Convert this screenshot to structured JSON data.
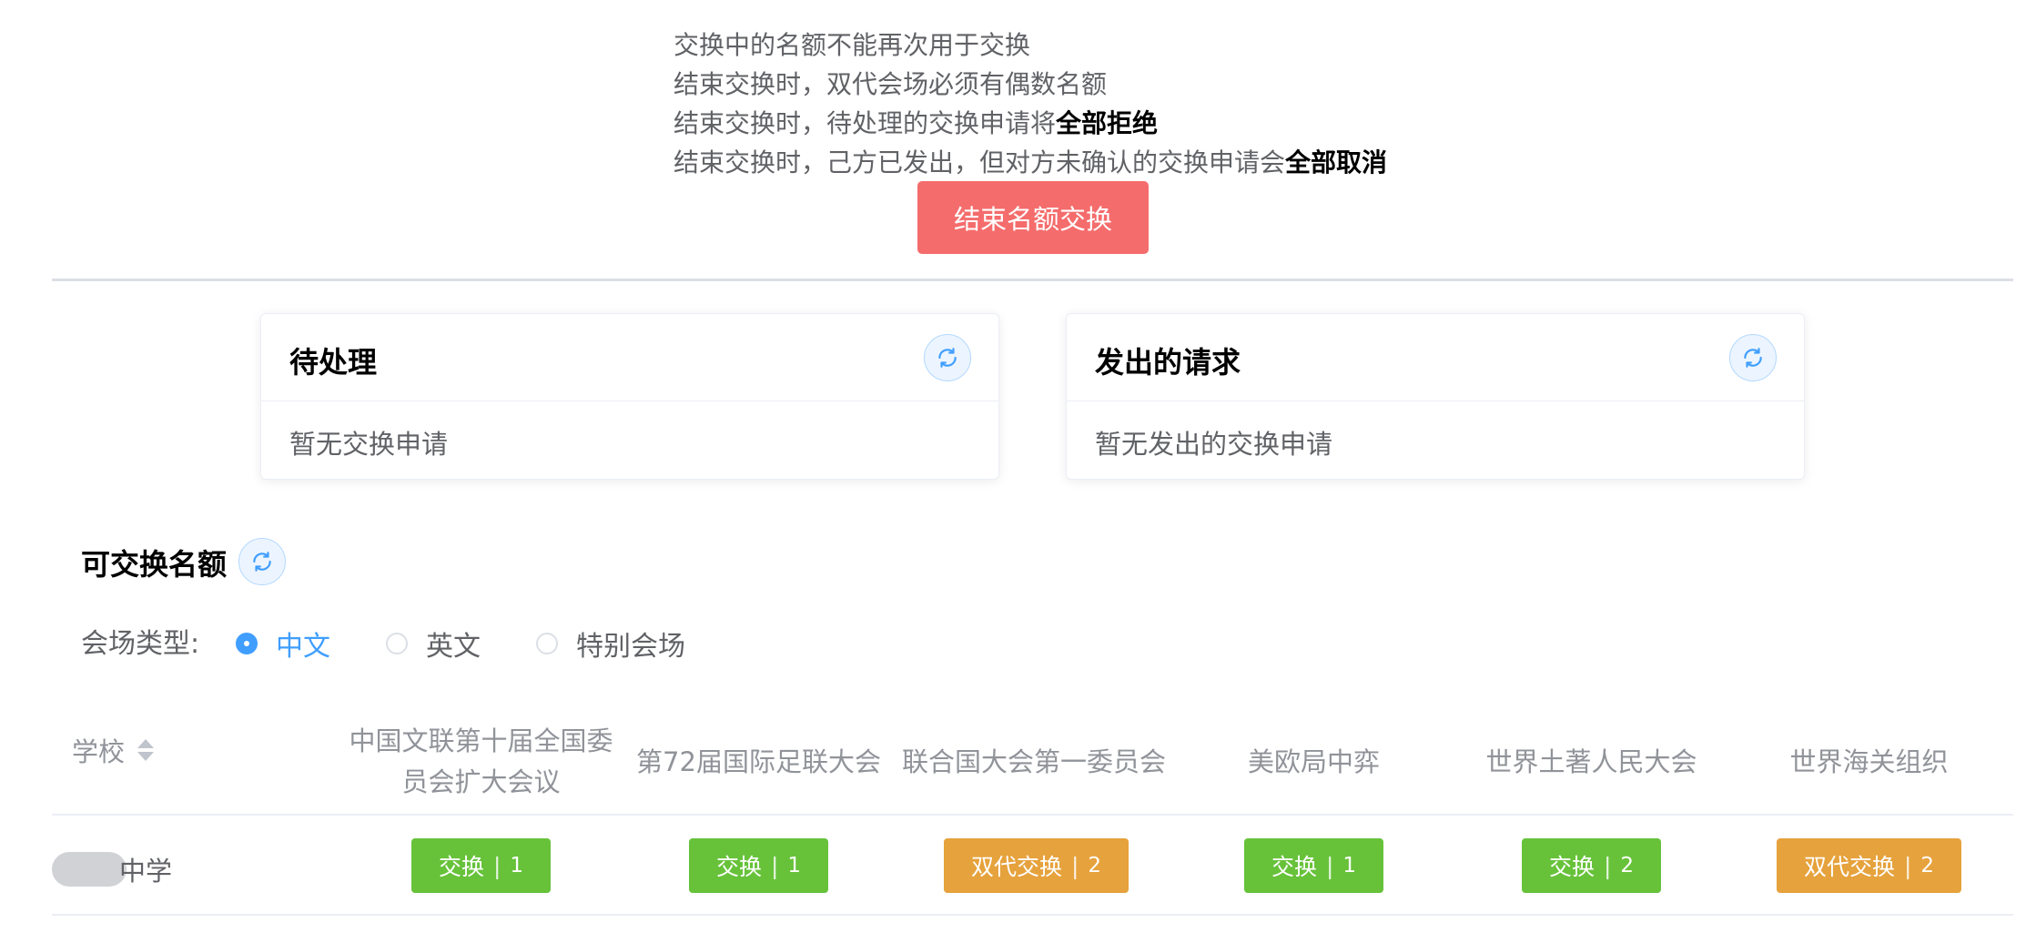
{
  "notice": {
    "line1": "交换中的名额不能再次用于交换",
    "line2": "结束交换时，双代会场必须有偶数名额",
    "line3_prefix": "结束交换时，待处理的交换申请将",
    "line3_bold": "全部拒绝",
    "line4_prefix": "结束交换时，己方已发出，但对方未确认的交换申请会",
    "line4_bold": "全部取消"
  },
  "end_button_label": "结束名额交换",
  "pending": {
    "title": "待处理",
    "empty_text": "暂无交换申请"
  },
  "sent": {
    "title": "发出的请求",
    "empty_text": "暂无发出的交换申请"
  },
  "available": {
    "title": "可交换名额"
  },
  "venue_type": {
    "label": "会场类型:",
    "options": [
      "中文",
      "英文",
      "特别会场"
    ],
    "selected": "中文"
  },
  "table": {
    "school_header": "学校",
    "columns": [
      "中国文联第十届全国委员会扩大会议",
      "第72届国际足联大会",
      "联合国大会第一委员会",
      "美欧局中弈",
      "世界土著人民大会",
      "世界海关组织"
    ],
    "rows": [
      {
        "school": "中学",
        "cells": [
          {
            "label": "交换",
            "count": "1",
            "color": "#67c23a"
          },
          {
            "label": "交换",
            "count": "1",
            "color": "#67c23a"
          },
          {
            "label": "双代交换",
            "count": "2",
            "color": "#e6a23c"
          },
          {
            "label": "交换",
            "count": "1",
            "color": "#67c23a"
          },
          {
            "label": "交换",
            "count": "2",
            "color": "#67c23a"
          },
          {
            "label": "双代交换",
            "count": "2",
            "color": "#e6a23c"
          }
        ]
      }
    ]
  },
  "separator": "|",
  "colors": {
    "danger": "#f56c6c",
    "primary": "#409eff",
    "success": "#67c23a",
    "warning": "#e6a23c"
  }
}
